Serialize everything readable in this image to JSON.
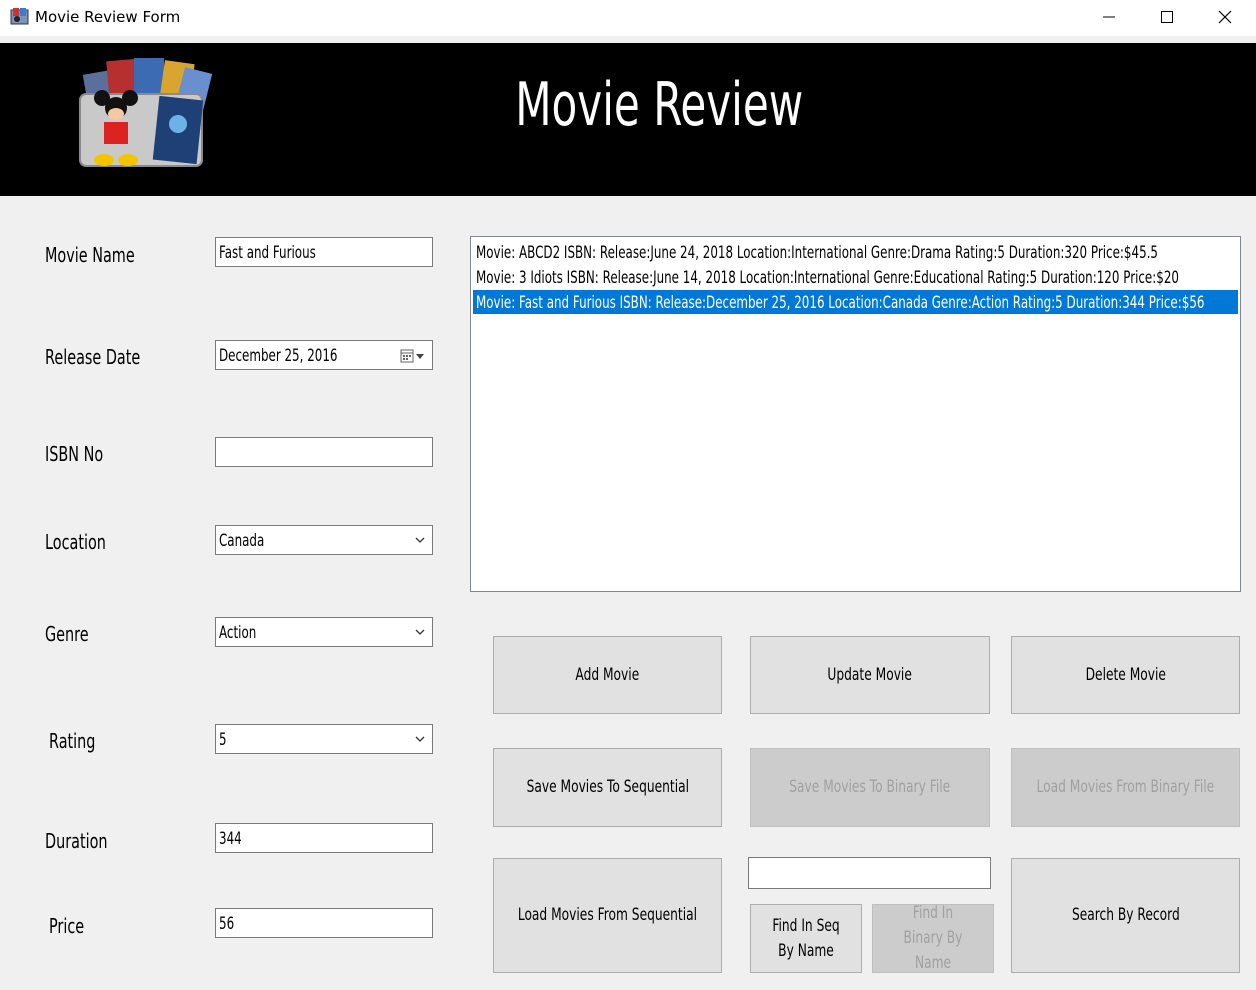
{
  "window": {
    "title": "Movie Review Form",
    "minimize_icon": "minimize-icon",
    "maximize_icon": "maximize-icon",
    "close_icon": "close-icon"
  },
  "banner": {
    "title": "Movie Review",
    "logo_icon": "movie-collection-logo"
  },
  "form": {
    "movie_name": {
      "label": "Movie Name",
      "value": "Fast and Furious"
    },
    "release_date": {
      "label": "Release Date",
      "value": "December 25,  2016"
    },
    "isbn": {
      "label": "ISBN No",
      "value": ""
    },
    "location": {
      "label": "Location",
      "value": "Canada"
    },
    "genre": {
      "label": "Genre",
      "value": "Action"
    },
    "rating": {
      "label": "Rating",
      "value": "5"
    },
    "duration": {
      "label": "Duration",
      "value": "344"
    },
    "price": {
      "label": "Price",
      "value": "56"
    }
  },
  "list": {
    "items": [
      "Movie:  ABCD2 ISBN:    Release:June 24, 2018  Location:International  Genre:Drama  Rating:5  Duration:320  Price:$45.5",
      "Movie:  3 Idiots ISBN:    Release:June 14, 2018  Location:International  Genre:Educational  Rating:5  Duration:120  Price:$20",
      "Movie:  Fast and Furious ISBN:    Release:December 25, 2016  Location:Canada  Genre:Action  Rating:5  Duration:344  Price:$56"
    ],
    "selected_index": 2
  },
  "buttons": {
    "add": "Add Movie",
    "update": "Update Movie",
    "delete": "Delete Movie",
    "save_seq": "Save Movies To Sequential",
    "save_bin": "Save Movies To Binary File",
    "load_bin": "Load Movies From Binary File",
    "load_seq": "Load Movies From Sequential",
    "find_seq": "Find In Seq By Name",
    "find_bin": "Find In Binary By Name",
    "search_record": "Search By Record"
  },
  "search": {
    "value": ""
  },
  "colors": {
    "selection": "#0078d7",
    "banner": "#000000"
  }
}
